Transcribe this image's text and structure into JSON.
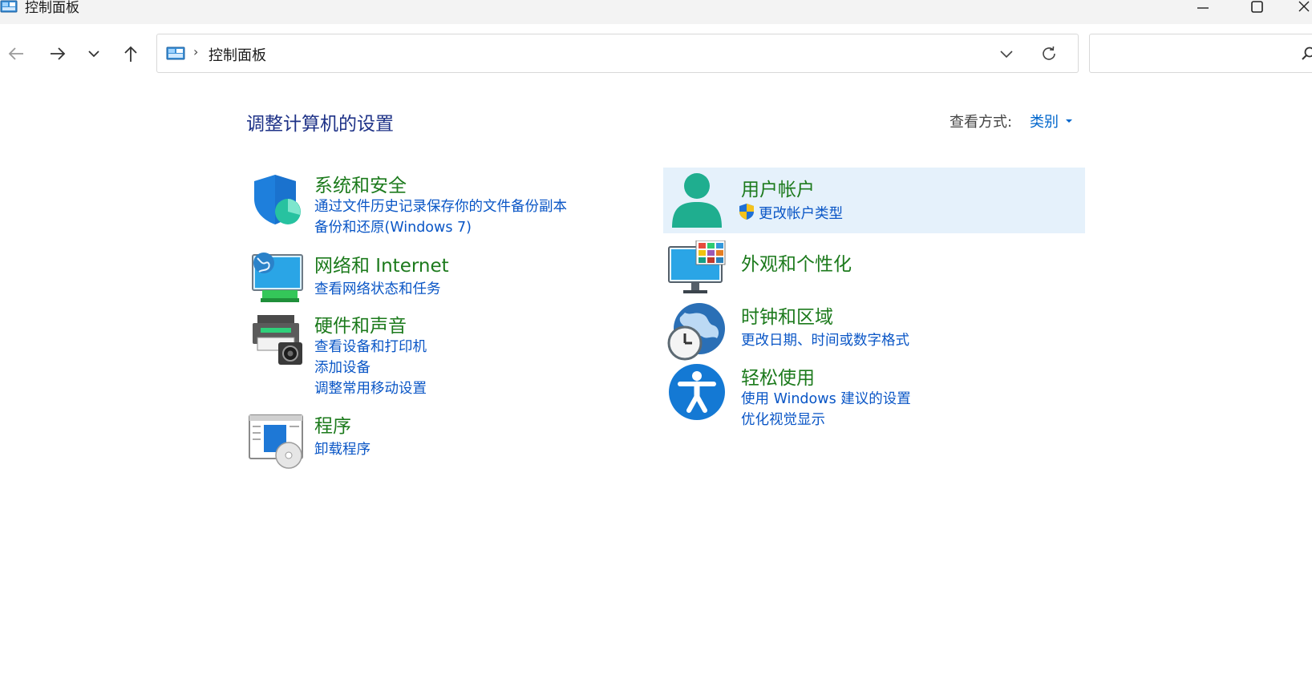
{
  "window": {
    "title": "控制面板"
  },
  "address": {
    "path": "控制面板",
    "separator": "›"
  },
  "search": {
    "placeholder": ""
  },
  "header": {
    "title": "调整计算机的设置",
    "view_by_label": "查看方式:",
    "view_by_value": "类别"
  },
  "categories": {
    "system": {
      "title": "系统和安全",
      "links": [
        "通过文件历史记录保存你的文件备份副本",
        "备份和还原(Windows 7)"
      ]
    },
    "network": {
      "title": "网络和 Internet",
      "links": [
        "查看网络状态和任务"
      ]
    },
    "hardware": {
      "title": "硬件和声音",
      "links": [
        "查看设备和打印机",
        "添加设备",
        "调整常用移动设置"
      ]
    },
    "programs": {
      "title": "程序",
      "links": [
        "卸载程序"
      ]
    },
    "users": {
      "title": "用户帐户",
      "links": [
        "更改帐户类型"
      ]
    },
    "appearance": {
      "title": "外观和个性化",
      "links": []
    },
    "clock": {
      "title": "时钟和区域",
      "links": [
        "更改日期、时间或数字格式"
      ]
    },
    "ease": {
      "title": "轻松使用",
      "links": [
        "使用 Windows 建议的设置",
        "优化视觉显示"
      ]
    }
  },
  "icons": {
    "title": "control-panel-icon",
    "back": "arrow-left-icon",
    "forward": "arrow-right-icon",
    "recent": "chevron-down-icon",
    "up": "arrow-up-icon",
    "refresh": "refresh-icon",
    "search": "search-icon",
    "minimize": "minimize-icon",
    "maximize": "maximize-icon",
    "close": "close-icon"
  },
  "colors": {
    "category_title": "#1c7a1c",
    "link": "#0a56c6",
    "page_title": "#1e3287",
    "highlight": "#e5f1fb"
  }
}
